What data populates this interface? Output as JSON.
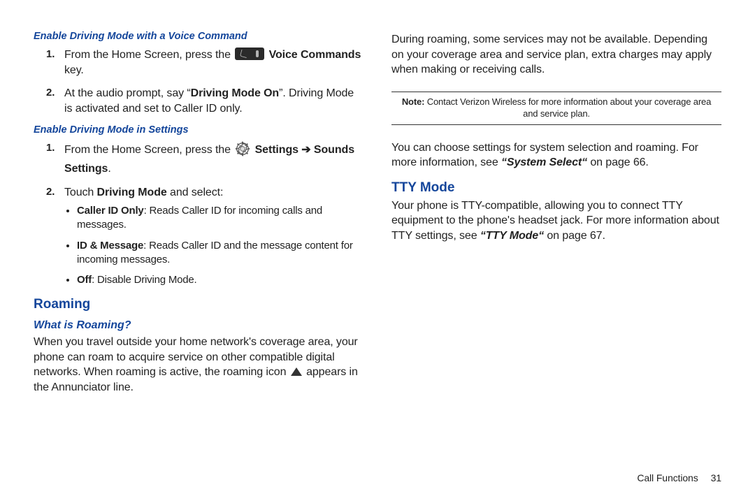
{
  "left": {
    "h5a": "Enable Driving Mode with a Voice Command",
    "step1a": "From the Home Screen, press the ",
    "step1b_bold": "Voice Commands",
    "step1c": " key.",
    "step2a": "At the audio prompt, say “",
    "step2b_bold": "Driving Mode On",
    "step2c": "”. Driving Mode is activated and set to Caller ID only.",
    "h5b": "Enable Driving Mode in Settings",
    "stepB1a": "From the Home Screen, press the ",
    "stepB1b_bold": "Settings ",
    "stepB1c_arrow": "➔ ",
    "stepB1d_bold": "Sounds Settings",
    "stepB1e": ".",
    "stepB2a": "Touch ",
    "stepB2b_bold": "Driving Mode",
    "stepB2c": " and select:",
    "bullet1_label": "Caller ID Only",
    "bullet1_text": ": Reads Caller ID for incoming calls and messages.",
    "bullet2_label": "ID & Message",
    "bullet2_text": ": Reads Caller ID and the message content for incoming messages.",
    "bullet3_label": "Off",
    "bullet3_text": ": Disable Driving Mode.",
    "h3_roaming": "Roaming",
    "h4_whatis": "What is Roaming?",
    "roaming_pa": "When you travel outside your home network's coverage area, your phone can roam to acquire service on other compatible digital networks. When roaming is active, the roaming icon ",
    "roaming_pb": " appears in the Annunciator line."
  },
  "right": {
    "roaming_continued": "During roaming, some services may not be available. Depending on your coverage area and service plan, extra charges may apply when making or receiving calls.",
    "note_label": "Note:",
    "note_text": " Contact Verizon Wireless for more information about your coverage area and service plan.",
    "syssel_a": "You can choose settings for system selection and roaming. For more information, see ",
    "syssel_ref": "“System Select“",
    "syssel_b": " on page 66.",
    "h3_tty": "TTY Mode",
    "tty_a": "Your phone is TTY-compatible, allowing you to connect TTY equipment to the phone's headset jack. For more information about TTY settings, see ",
    "tty_ref": "“TTY Mode“",
    "tty_b": " on page 67."
  },
  "footer": {
    "section": "Call Functions",
    "page": "31"
  }
}
